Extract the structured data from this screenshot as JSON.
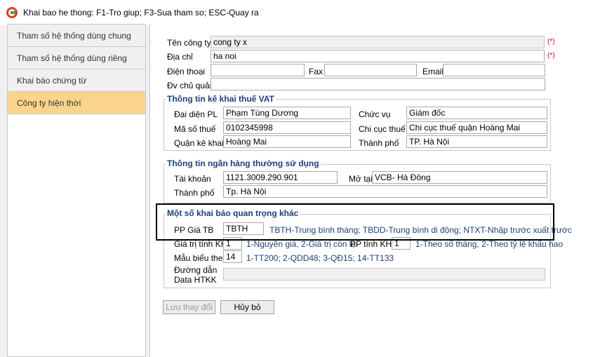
{
  "window": {
    "title": "Khai bao he thong: F1-Tro giup; F3-Sua tham so; ESC-Quay ra"
  },
  "sidebar": {
    "items": [
      {
        "label": "Tham số hệ thống dùng chung"
      },
      {
        "label": "Tham số hệ thống dùng riêng"
      },
      {
        "label": "Khai báo chứng từ"
      },
      {
        "label": "Công ty hiện thời"
      }
    ]
  },
  "company": {
    "name_label": "Tên công ty",
    "name_value": "cong ty x",
    "address_label": "Địa chỉ",
    "address_value": "ha noi",
    "required_mark": "(*)",
    "phone_label": "Điện thoại",
    "phone_value": "",
    "fax_label": "Fax",
    "fax_value": "",
    "email_label": "Email",
    "email_value": "",
    "parent_label": "Đv chủ quản",
    "parent_value": ""
  },
  "vat": {
    "title": "Thông tin kê khai thuế VAT",
    "rep_label": "Đại diện PL",
    "rep_value": "Phạm Tùng Dương",
    "position_label": "Chức vụ",
    "position_value": "Giám đốc",
    "taxcode_label": "Mã số thuế",
    "taxcode_value": "0102345998",
    "dept_label": "Chi cục thuế",
    "dept_value": "Chi cục thuế quận Hoàng Mai",
    "district_label": "Quận kê khai",
    "district_value": "Hoàng Mai",
    "city_label": "Thành phố",
    "city_value": "TP. Hà Nội"
  },
  "bank": {
    "title": "Thông tin ngân hàng thường sử dụng",
    "account_label": "Tài khoản",
    "account_value": "1121.3009.290.901",
    "opened_label": "Mở tại",
    "opened_value": "VCB- Hà Đông",
    "city_label": "Thành phố",
    "city_value": "Tp. Hà Nội"
  },
  "other": {
    "title": "Một số khai báo quan trọng khác",
    "pp_label": "PP Giá TB",
    "pp_value": "TBTH",
    "pp_hint": "TBTH-Trung bình tháng; TBDD-Trung bình di động; NTXT-Nhập trước xuất trước",
    "value_label": "Giá trị tính KH",
    "value_value": "1",
    "value_hint": "1-Nguyên giá, 2-Giá trị còn lại",
    "method_label": "PP tính KH",
    "method_value": "1",
    "method_hint": "1-Theo số tháng, 2-Theo tỷ lệ khấu hao",
    "template_label": "Mẫu biểu theo",
    "template_value": "14",
    "template_hint": "1-TT200; 2-QDD48; 3-QĐ15; 14-TT133",
    "path_label_1": "Đường dẫn",
    "path_label_2": "Data HTKK",
    "path_value": ""
  },
  "buttons": {
    "save": "Lưu thay đổi",
    "cancel": "Hủy bỏ"
  }
}
